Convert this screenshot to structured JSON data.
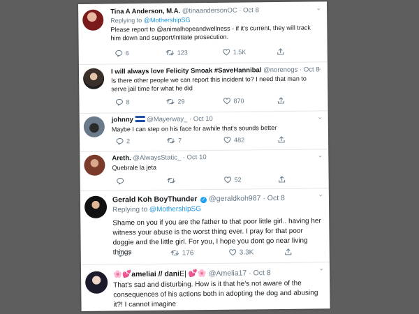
{
  "tweets": [
    {
      "name": "Tina A Anderson, M.A.",
      "handle": "@tinaandersonOC",
      "dot_date": "· Oct 8",
      "replying_prefix": "Replying to ",
      "replying_to": "@MothershipSG",
      "text": "Please report to @animalhopeandwellness - if it's current, they will track him down and support/initiate prosecution.",
      "replies": "6",
      "retweets": "123",
      "likes": "1.5K"
    },
    {
      "name": "I will always love Felicity Smoak #SaveHannibal",
      "handle": "@norenogs",
      "dot_date": "· Oct 8",
      "text": "Is there other people we can report this incident to? I need that man to serve jail time for what he did",
      "replies": "8",
      "retweets": "29",
      "likes": "870"
    },
    {
      "name": "johnny",
      "handle": "@Mayerway_",
      "dot_date": "· Oct 10",
      "text": "Maybe I can step on his face for awhile that's sounds better",
      "replies": "2",
      "retweets": "7",
      "likes": "482"
    },
    {
      "name": "Areth.",
      "handle": "@AlwaysStatic_",
      "dot_date": "· Oct 10",
      "text": "Quebrale la jeta",
      "replies": "",
      "retweets": "",
      "likes": "52"
    },
    {
      "name": "Gerald Koh BoyThunder",
      "handle": "@geraldkoh987",
      "dot_date": "· Oct 8",
      "replying_prefix": "Replying to ",
      "replying_to": "@MothershipSG",
      "text": "Shame on you if you are the father to that poor little girl.. having her witness your abuse is the worst thing ever. I pray for that poor doggie and the little girl. For you, I hope you dont go near living things",
      "replies": "7",
      "retweets": "176",
      "likes": "3.3K"
    },
    {
      "name_prefix": "🌸💕",
      "name": "ameliai // dani",
      "name_suffix": "E| 💕🌸",
      "handle": "@Amelia17",
      "dot_date": "· Oct 8",
      "text": "That's sad and disturbing. How is it that he's not aware of the consequences of his actions both in adopting the dog and abusing it?! I cannot imagine"
    }
  ],
  "colors": {
    "link": "#1b95e0",
    "meta": "#657786",
    "background": "#5e5e5e"
  },
  "icons": [
    "reply-icon",
    "retweet-icon",
    "like-icon",
    "share-icon",
    "verified-icon",
    "caret-down-icon",
    "flag-icon"
  ]
}
